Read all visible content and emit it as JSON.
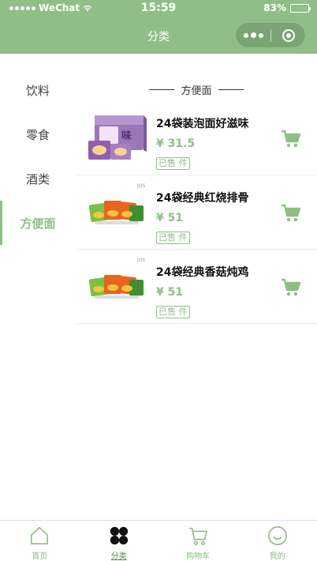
{
  "status_bar": {
    "carrier": "WeChat",
    "time": "15:59",
    "battery": "83%",
    "battery_level": 0.83
  },
  "nav": {
    "title": "分类"
  },
  "sidebar": {
    "items": [
      {
        "label": "饮料",
        "active": false
      },
      {
        "label": "零食",
        "active": false
      },
      {
        "label": "酒类",
        "active": false
      },
      {
        "label": "方便面",
        "active": true
      }
    ]
  },
  "section": {
    "title": "方便面"
  },
  "products": [
    {
      "name": "24袋装泡面好滋味",
      "price": "¥ 31.5",
      "sold": "已售 件",
      "image": "instant-noodle-box-icon"
    },
    {
      "name": "24袋经典红烧排骨",
      "price": "¥ 51",
      "sold": "已售 件",
      "image": "instant-noodle-packs-icon",
      "watermark": "JOS"
    },
    {
      "name": "24袋经典香菇炖鸡",
      "price": "¥ 51",
      "sold": "已售 件",
      "image": "instant-noodle-packs-icon",
      "watermark": "JOS"
    }
  ],
  "tabbar": {
    "items": [
      {
        "label": "首页",
        "icon": "home-icon",
        "active": false
      },
      {
        "label": "分类",
        "icon": "category-icon",
        "active": true
      },
      {
        "label": "购物车",
        "icon": "cart-icon",
        "active": false
      },
      {
        "label": "我的",
        "icon": "smile-icon",
        "active": false
      }
    ]
  },
  "colors": {
    "accent": "#8fbf87",
    "accent_dark": "#4e8f45"
  }
}
